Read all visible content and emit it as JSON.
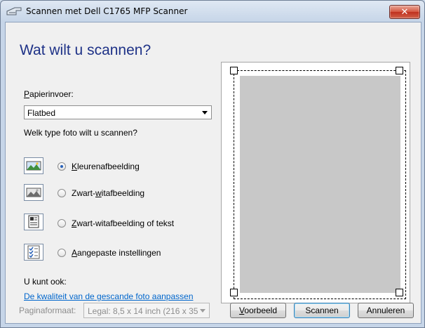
{
  "window": {
    "title": "Scannen met Dell C1765 MFP Scanner",
    "close_glyph": "✕"
  },
  "main": {
    "heading": "Wat wilt u scannen?",
    "paper_source": {
      "label_pre": "",
      "label_accel": "P",
      "label_post": "apierinvoer:",
      "value": "Flatbed"
    },
    "photo_type_label": "Welk type foto wilt u scannen?",
    "options": [
      {
        "pre": "",
        "accel": "K",
        "post": "leurenafbeelding",
        "selected": true,
        "icon": "color-picture-icon"
      },
      {
        "pre": "Zwart-",
        "accel": "w",
        "post": "itafbeelding",
        "selected": false,
        "icon": "grayscale-picture-icon"
      },
      {
        "pre": "",
        "accel": "Z",
        "post": "wart-witafbeelding of tekst",
        "selected": false,
        "icon": "black-white-text-icon"
      },
      {
        "pre": "",
        "accel": "A",
        "post": "angepaste instellingen",
        "selected": false,
        "icon": "custom-settings-icon"
      }
    ],
    "also_label": "U kunt ook:",
    "adjust_link": "De kwaliteit van de gescande foto aanpassen",
    "page_size": {
      "label": "Paginaformaat:",
      "value": "Legal: 8,5 x 14 inch (216 x 35"
    }
  },
  "buttons": {
    "preview_pre": "",
    "preview_accel": "V",
    "preview_post": "oorbeeld",
    "scan": "Scannen",
    "cancel": "Annuleren"
  },
  "colors": {
    "heading": "#1e3287",
    "link": "#0066cc",
    "preview_gray": "#c8c8c8"
  }
}
